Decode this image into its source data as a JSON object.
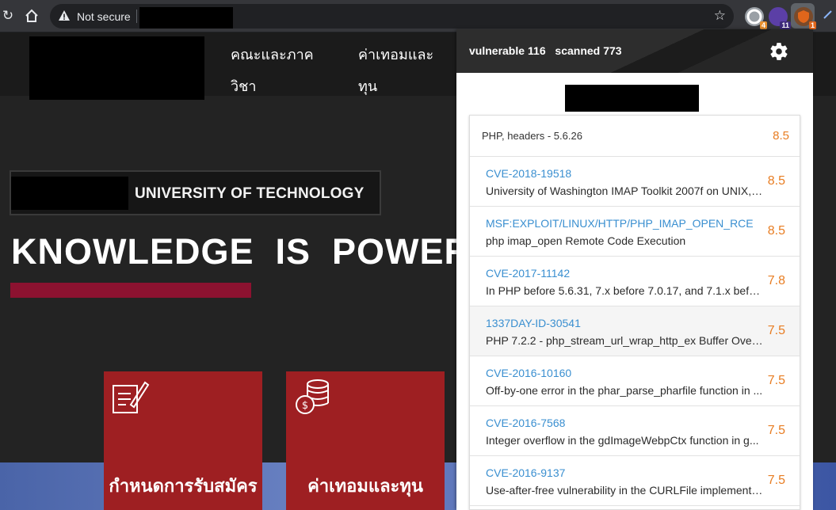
{
  "browser": {
    "security_label": "Not secure",
    "extensions": [
      {
        "icon": "cyan-circle-extension-icon",
        "badge": "4",
        "badge_color": "#e8902d"
      },
      {
        "icon": "purple-extension-icon",
        "badge": "11",
        "badge_color": "#5b3fa6"
      },
      {
        "icon": "orange-shield-extension-icon",
        "badge": "1",
        "badge_color": "#e0661b"
      }
    ]
  },
  "site": {
    "nav": [
      {
        "line1": "คณะและภาค",
        "line2": "วิชา"
      },
      {
        "line1": "ค่าเทอมและ",
        "line2": "ทุน"
      }
    ],
    "university_label": "UNIVERSITY OF TECHNOLOGY",
    "headline": "KNOWLEDGE  IS  POWER",
    "tiles": [
      {
        "label": "กำหนดการรับสมัคร",
        "icon": "application-form-icon"
      },
      {
        "label": "ค่าเทอมและทุน",
        "icon": "coin-stack-icon"
      }
    ],
    "colors": {
      "accent_bar": "#8c1230",
      "tile": "#9e1f22"
    }
  },
  "popup": {
    "vulnerable_label": "vulnerable",
    "vulnerable_count": "116",
    "scanned_label": "scanned",
    "scanned_count": "773",
    "software": {
      "title": "PHP, headers - 5.6.26",
      "score": "8.5"
    },
    "items": [
      {
        "id": "CVE-2018-19518",
        "desc": "University of Washington IMAP Toolkit 2007f on UNIX, ...",
        "score": "8.5"
      },
      {
        "id": "MSF:EXPLOIT/LINUX/HTTP/PHP_IMAP_OPEN_RCE",
        "desc": "php imap_open Remote Code Execution",
        "score": "8.5"
      },
      {
        "id": "CVE-2017-11142",
        "desc": "In PHP before 5.6.31, 7.x before 7.0.17, and 7.1.x befor...",
        "score": "7.8"
      },
      {
        "id": "1337DAY-ID-30541",
        "desc": "PHP 7.2.2 - php_stream_url_wrap_http_ex Buffer Overfl...",
        "score": "7.5"
      },
      {
        "id": "CVE-2016-10160",
        "desc": "Off-by-one error in the phar_parse_pharfile function in ...",
        "score": "7.5"
      },
      {
        "id": "CVE-2016-7568",
        "desc": "Integer overflow in the gdImageWebpCtx function in g...",
        "score": "7.5"
      },
      {
        "id": "CVE-2016-9137",
        "desc": "Use-after-free vulnerability in the CURLFile implementa...",
        "score": "7.5"
      }
    ],
    "colors": {
      "link": "#3a8fd0",
      "score": "#e87d22"
    }
  }
}
